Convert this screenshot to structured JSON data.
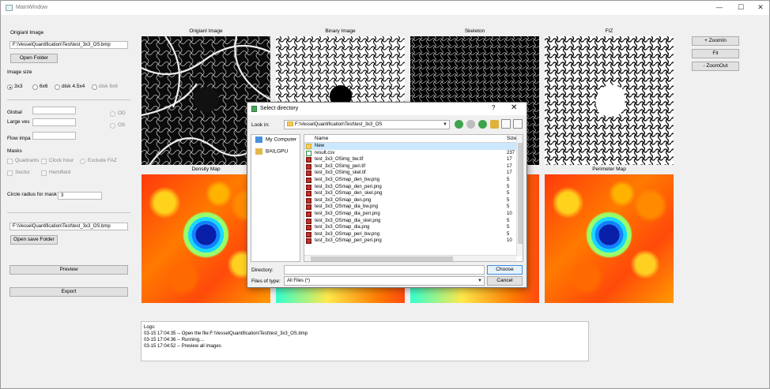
{
  "window": {
    "title": "MainWindow",
    "minimize": "—",
    "maximize": "☐",
    "close": "✕"
  },
  "left": {
    "original_label": "Origianl Image",
    "original_path": "F:\\VesselQuantification\\Test\\test_3x3_OS.bmp",
    "open_folder": "Open Folder",
    "image_size_label": "Image size",
    "size_options": [
      "3x3",
      "6x6",
      "disk 4.5x4",
      "disk 6x6"
    ],
    "selected_size": "3x3",
    "global_label": "Global",
    "large_ves_label": "Large ves",
    "flow_impa_label": "Flow impa",
    "od_label": "OD",
    "os_label": "OS",
    "masks_label": "Masks",
    "mask_options": [
      "Quadrants",
      "Clock hour",
      "Exclude FAZ",
      "Sector",
      "Hemifield"
    ],
    "circle_radius_label": "Circle radius for mask",
    "circle_radius_value": "3",
    "save_path": "F:\\VesselQuantification\\Test\\test_3x3_OS.bmp",
    "open_save_folder": "Open save Folder",
    "preview": "Preview",
    "export": "Export"
  },
  "images": {
    "original": "Origianl Image",
    "binary": "Binary Image",
    "skeleton": "Skeleton",
    "fiz": "FIZ",
    "density": "Density Map",
    "perimeter": "Perimeter  Map"
  },
  "zoom": {
    "zoom_in": "+ ZoomIn",
    "fit": "Fit",
    "zoom_out": "- ZoomOut"
  },
  "logs": {
    "header": "Logs:",
    "lines": [
      "03-15 17:04:35 -- Open the file:F:\\VesselQuantification\\Test\\test_3x3_OS.bmp",
      "03-15 17:04:36 -- Running....",
      "03-15 17:04:52 -- Preview all images"
    ]
  },
  "dialog": {
    "title": "Select directory",
    "help": "?",
    "close": "✕",
    "look_in_label": "Look in:",
    "look_in_value": "F:\\VesselQuantification\\Test\\test_3x3_OS",
    "sidebar": [
      "My Computer",
      "BAILGPU"
    ],
    "col_name": "Name",
    "col_size": "Size",
    "files": [
      {
        "name": "New",
        "size": "",
        "type": "folder"
      },
      {
        "name": "result.csv",
        "size": "237",
        "type": "csv"
      },
      {
        "name": "test_3x3_OSimg_bw.tif",
        "size": "17",
        "type": "img"
      },
      {
        "name": "test_3x3_OSimg_peri.tif",
        "size": "17",
        "type": "img"
      },
      {
        "name": "test_3x3_OSimg_skel.tif",
        "size": "17",
        "type": "img"
      },
      {
        "name": "test_3x3_OSmap_den_bw.png",
        "size": "5",
        "type": "img"
      },
      {
        "name": "test_3x3_OSmap_den_peri.png",
        "size": "5",
        "type": "img"
      },
      {
        "name": "test_3x3_OSmap_den_skel.png",
        "size": "5",
        "type": "img"
      },
      {
        "name": "test_3x3_OSmap_den.png",
        "size": "5",
        "type": "img"
      },
      {
        "name": "test_3x3_OSmap_dia_bw.png",
        "size": "5",
        "type": "img"
      },
      {
        "name": "test_3x3_OSmap_dia_peri.png",
        "size": "10",
        "type": "img"
      },
      {
        "name": "test_3x3_OSmap_dia_skel.png",
        "size": "5",
        "type": "img"
      },
      {
        "name": "test_3x3_OSmap_dia.png",
        "size": "5",
        "type": "img"
      },
      {
        "name": "test_3x3_OSmap_peri_bw.png",
        "size": "5",
        "type": "img"
      },
      {
        "name": "test_3x3_OSmap_peri_peri.png",
        "size": "10",
        "type": "img"
      }
    ],
    "directory_label": "Directory:",
    "directory_value": "",
    "files_of_type_label": "Files of type:",
    "files_of_type_value": "All Files (*)",
    "choose": "Choose",
    "cancel": "Cancel"
  }
}
